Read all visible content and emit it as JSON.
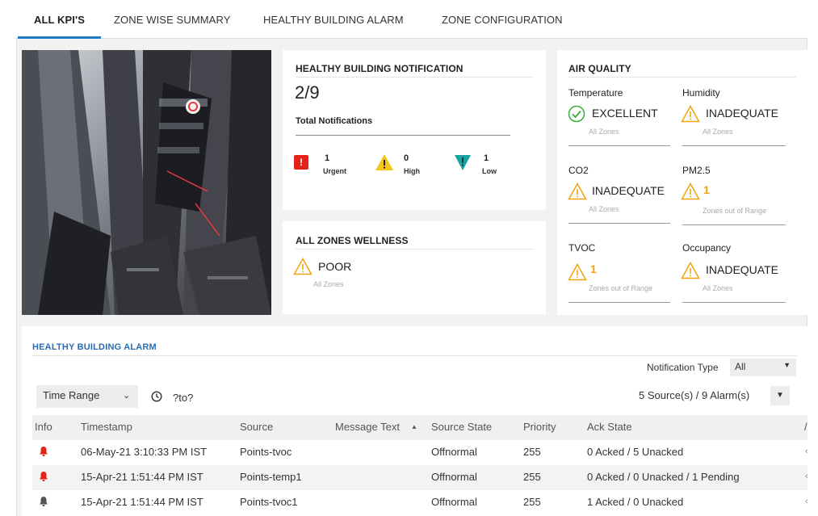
{
  "tabs": [
    {
      "label": "ALL KPI'S",
      "active": true
    },
    {
      "label": "ZONE WISE SUMMARY",
      "active": false
    },
    {
      "label": "HEALTHY BUILDING ALARM",
      "active": false
    },
    {
      "label": "ZONE CONFIGURATION",
      "active": false
    }
  ],
  "notification": {
    "title": "HEALTHY BUILDING NOTIFICATION",
    "count": "2/9",
    "total_label": "Total Notifications",
    "urgent": {
      "count": "1",
      "label": "Urgent",
      "color": "#e32319"
    },
    "high": {
      "count": "0",
      "label": "High",
      "color": "#f5c518"
    },
    "low": {
      "count": "1",
      "label": "Low",
      "color": "#1aa3a3"
    }
  },
  "wellness": {
    "title": "ALL ZONES WELLNESS",
    "value": "POOR",
    "sub": "All Zones"
  },
  "air_quality": {
    "title": "AIR QUALITY",
    "items": [
      {
        "name": "Temperature",
        "value": "EXCELLENT",
        "sub": "All Zones",
        "icon": "check-circle-icon"
      },
      {
        "name": "Humidity",
        "value": "INADEQUATE",
        "sub": "All Zones",
        "icon": "warning-icon"
      },
      {
        "name": "CO2",
        "value": "INADEQUATE",
        "sub": "All Zones",
        "icon": "warning-icon"
      },
      {
        "name": "PM2.5",
        "value": "1",
        "sub": "Zones out of Range",
        "icon": "warning-icon"
      },
      {
        "name": "TVOC",
        "value": "1",
        "sub": "Zones out of Range",
        "icon": "warning-icon"
      },
      {
        "name": "Occupancy",
        "value": "INADEQUATE",
        "sub": "All Zones",
        "icon": "warning-icon"
      }
    ]
  },
  "alarm": {
    "title": "HEALTHY BUILDING ALARM",
    "notification_type_label": "Notification Type",
    "notification_type_value": "All",
    "time_range_label": "Time Range",
    "time_range_value": "?to?",
    "summary": "5 Source(s) / 9 Alarm(s)",
    "columns": [
      "Info",
      "Timestamp",
      "Source",
      "Message Text",
      "Source State",
      "Priority",
      "Ack State"
    ],
    "rows": [
      {
        "bell": "red",
        "timestamp": "06-May-21 3:10:33 PM IST",
        "source": "Points-tvoc",
        "message": "",
        "state": "Offnormal",
        "priority": "255",
        "ack": "0 Acked / 5 Unacked"
      },
      {
        "bell": "red",
        "timestamp": "15-Apr-21 1:51:44 PM IST",
        "source": "Points-temp1",
        "message": "",
        "state": "Offnormal",
        "priority": "255",
        "ack": "0 Acked / 0 Unacked / 1 Pending"
      },
      {
        "bell": "gray",
        "timestamp": "15-Apr-21 1:51:44 PM IST",
        "source": "Points-tvoc1",
        "message": "",
        "state": "Offnormal",
        "priority": "255",
        "ack": "1 Acked / 0 Unacked"
      }
    ]
  },
  "colors": {
    "accent": "#1e7bc8",
    "warning": "#f0a30a",
    "ok": "#3bab3a",
    "bell_red": "#e32319",
    "bell_gray": "#555555",
    "section_title": "#2a6db2"
  }
}
